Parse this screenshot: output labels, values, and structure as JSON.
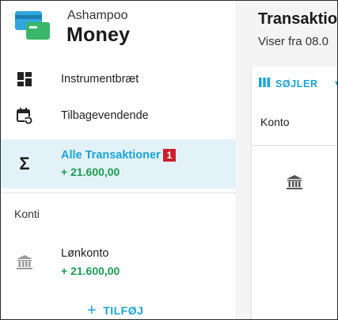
{
  "brand": {
    "top": "Ashampoo",
    "main": "Money"
  },
  "sidebar": {
    "items": [
      {
        "label": "Instrumentbræt",
        "icon": "dashboard-icon"
      },
      {
        "label": "Tilbagevendende",
        "icon": "calendar-recurring-icon"
      },
      {
        "label": "Alle Transaktioner",
        "amount": "+ 21.600,00",
        "badge": "1",
        "icon": "sigma-icon",
        "selected": true
      }
    ],
    "section_title": "Konti",
    "accounts": [
      {
        "label": "Lønkonto",
        "amount": "+ 21.600,00",
        "icon": "bank-icon"
      }
    ],
    "add_label": "TILFØJ",
    "add_icon": "plus-icon"
  },
  "main": {
    "title": "Transaktio",
    "subtitle": "Viser fra 08.0",
    "columns_button": "SØJLER",
    "columns_icon": "columns-icon",
    "column_header": "Konto",
    "row_icon": "bank-icon"
  },
  "colors": {
    "accent": "#1aa3d6",
    "positive": "#1e9b52",
    "selected_bg": "#e3f2f8",
    "badge": "#c8202f"
  }
}
